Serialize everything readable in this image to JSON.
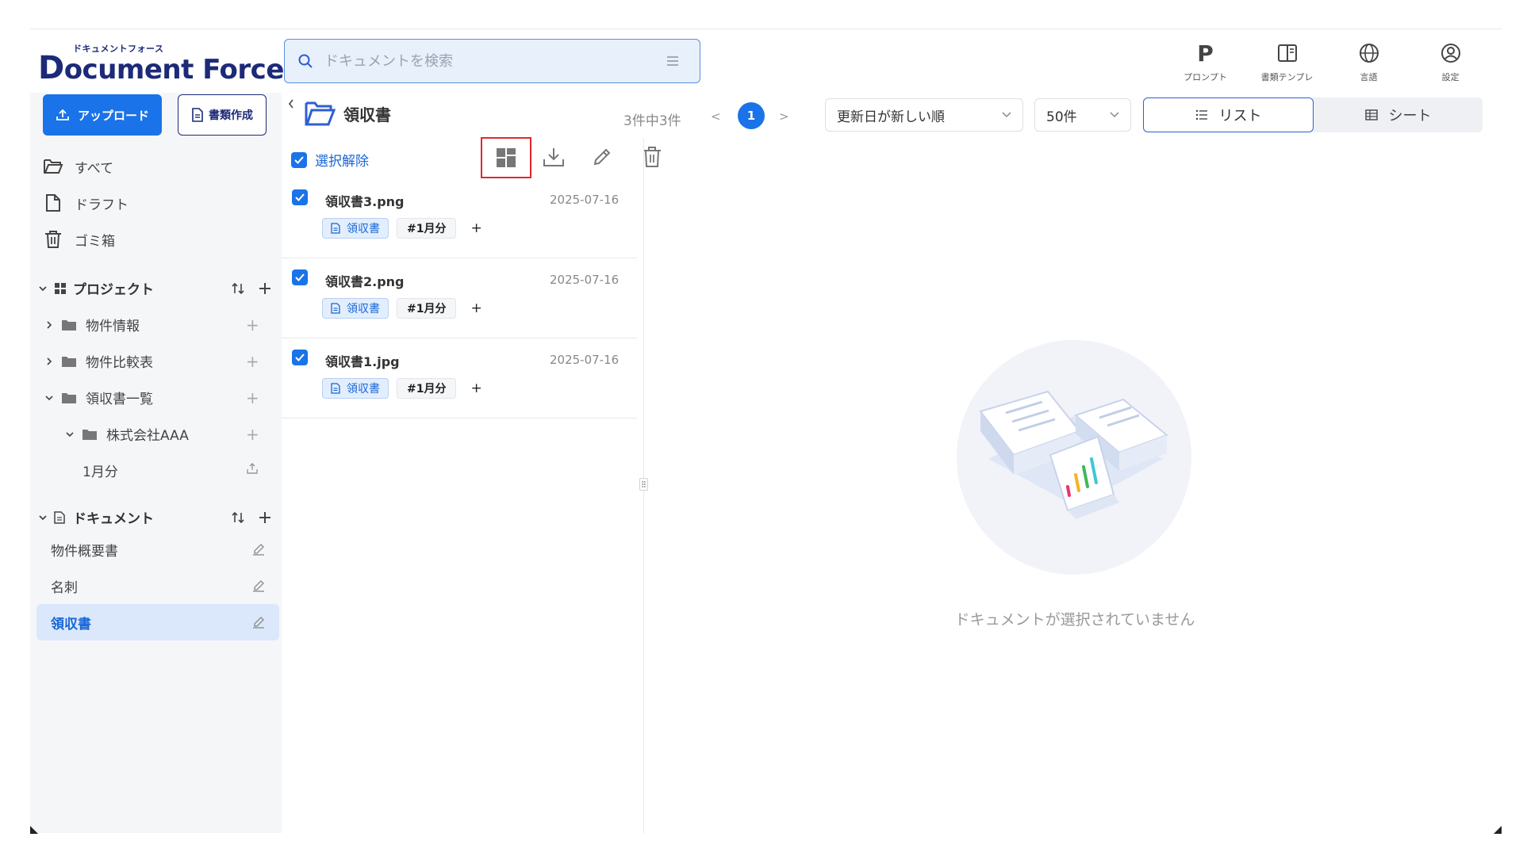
{
  "app": {
    "logo_subtitle": "ドキュメントフォース",
    "logo_d": "D",
    "logo_text": "ocument Force"
  },
  "search": {
    "placeholder": "ドキュメントを検索"
  },
  "top_actions": [
    {
      "label": "プロンプト",
      "icon": "prompt-p-icon"
    },
    {
      "label": "書類テンプレ",
      "icon": "template-icon"
    },
    {
      "label": "言語",
      "icon": "globe-icon"
    },
    {
      "label": "設定",
      "icon": "user-settings-icon"
    }
  ],
  "sidebar": {
    "upload_label": "アップロード",
    "create_label": "書類作成",
    "nav": [
      {
        "label": "すべて",
        "icon": "folder-open-icon"
      },
      {
        "label": "ドラフト",
        "icon": "file-icon"
      },
      {
        "label": "ゴミ箱",
        "icon": "trash-icon"
      }
    ],
    "projects_label": "プロジェクト",
    "projects": [
      {
        "label": "物件情報"
      },
      {
        "label": "物件比較表"
      },
      {
        "label": "領収書一覧"
      },
      {
        "label": "株式会社AAA"
      },
      {
        "label": "1月分"
      }
    ],
    "documents_label": "ドキュメント",
    "documents": [
      {
        "label": "物件概要書"
      },
      {
        "label": "名刺"
      },
      {
        "label": "領収書"
      }
    ]
  },
  "main": {
    "folder_title": "領収書",
    "count_text": "3件中3件",
    "page_prev": "<",
    "page_current": "1",
    "page_next": ">",
    "sort_value": "更新日が新しい順",
    "page_size_value": "50件",
    "view_list_label": "リスト",
    "view_sheet_label": "シート",
    "select_clear_label": "選択解除",
    "empty_message": "ドキュメントが選択されていません"
  },
  "files": [
    {
      "name": "領収書3.png",
      "date": "2025-07-16",
      "type_tag": "領収書",
      "hash_tag": "#1月分"
    },
    {
      "name": "領収書2.png",
      "date": "2025-07-16",
      "type_tag": "領収書",
      "hash_tag": "#1月分"
    },
    {
      "name": "領収書1.jpg",
      "date": "2025-07-16",
      "type_tag": "領収書",
      "hash_tag": "#1月分"
    }
  ],
  "colors": {
    "primary": "#1a73e8",
    "brand_navy": "#1c2a78",
    "highlight_red": "#e0282e"
  }
}
